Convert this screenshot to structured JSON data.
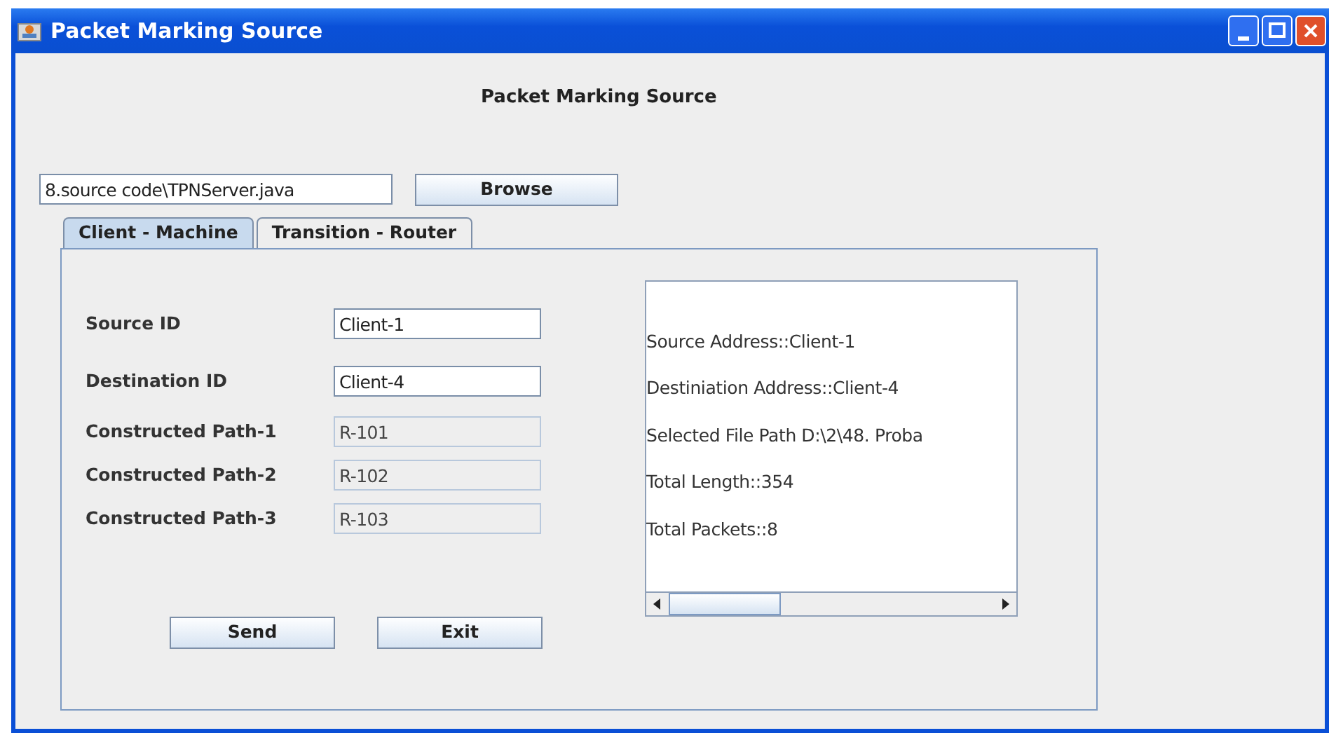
{
  "window": {
    "title": "Packet Marking Source"
  },
  "heading": "Packet Marking Source",
  "file_field": {
    "value": "8.source code\\TPNServer.java"
  },
  "browse_button": "Browse",
  "tabs": [
    {
      "label": "Client - Machine",
      "selected": true
    },
    {
      "label": "Transition - Router",
      "selected": false
    }
  ],
  "form": [
    {
      "label": "Source ID",
      "value": "Client-1",
      "disabled": false
    },
    {
      "label": "Destination ID",
      "value": "Client-4",
      "disabled": false
    },
    {
      "label": "Constructed Path-1",
      "value": "R-101",
      "disabled": true
    },
    {
      "label": "Constructed Path-2",
      "value": "R-102",
      "disabled": true
    },
    {
      "label": "Constructed Path-3",
      "value": "R-103",
      "disabled": true
    }
  ],
  "output_lines": [
    "Source Address::Client-1",
    "Destiniation Address::Client-4",
    "Selected File Path D:\\2\\48. Proba",
    "Total Length::354",
    "Total Packets::8"
  ],
  "buttons": [
    "Send",
    "Exit"
  ]
}
